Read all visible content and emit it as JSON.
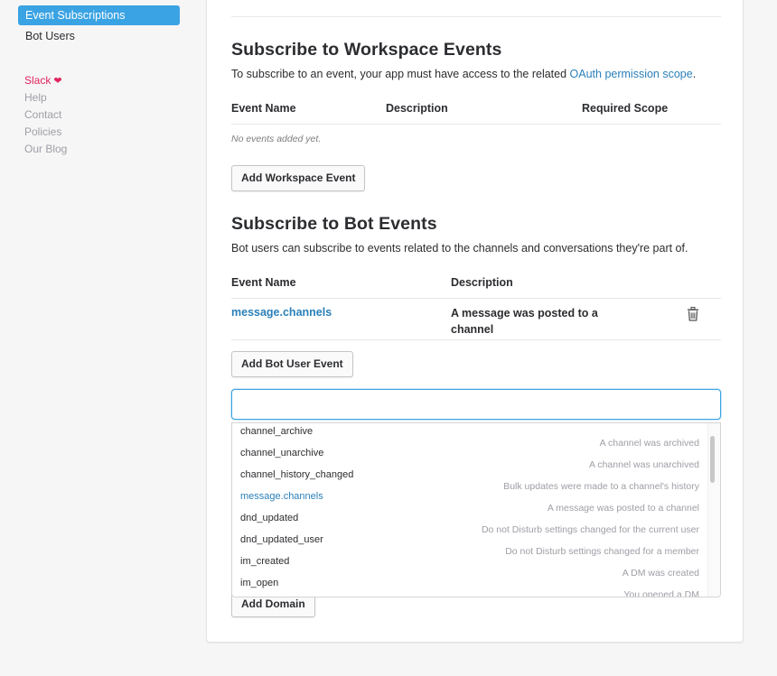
{
  "sidebar": {
    "items": [
      {
        "label": "Event Subscriptions",
        "active": true
      },
      {
        "label": "Bot Users",
        "active": false
      }
    ],
    "footer": {
      "slack": "Slack",
      "help": "Help",
      "contact": "Contact",
      "policies": "Policies",
      "blog": "Our Blog"
    }
  },
  "workspace_events": {
    "title": "Subscribe to Workspace Events",
    "subtitle_prefix": "To subscribe to an event, your app must have access to the related ",
    "subtitle_link": "OAuth permission scope",
    "subtitle_suffix": ".",
    "columns": [
      "Event Name",
      "Description",
      "Required Scope"
    ],
    "empty_text": "No events added yet.",
    "add_button": "Add Workspace Event"
  },
  "bot_events": {
    "title": "Subscribe to Bot Events",
    "subtitle": "Bot users can subscribe to events related to the channels and conversations they're part of.",
    "columns": [
      "Event Name",
      "Description"
    ],
    "rows": [
      {
        "name": "message.channels",
        "description": "A message was posted to a channel"
      }
    ],
    "add_button": "Add Bot User Event"
  },
  "event_search": {
    "value": "",
    "placeholder": ""
  },
  "dropdown": {
    "options": [
      {
        "name": "channel_archive",
        "description": ""
      },
      {
        "name": "channel_unarchive",
        "description": "A channel was archived"
      },
      {
        "name": "channel_history_changed",
        "description": "A channel was unarchived"
      },
      {
        "name": "message.channels",
        "description": "Bulk updates were made to a channel's history",
        "selected": true
      },
      {
        "name": "dnd_updated",
        "description": "A message was posted to a channel"
      },
      {
        "name": "dnd_updated_user",
        "description": "Do not Disturb settings changed for the current user"
      },
      {
        "name": "im_created",
        "description": "Do not Disturb settings changed for a member"
      },
      {
        "name": "im_open",
        "description": "A DM was created"
      },
      {
        "name": "",
        "description": "You opened a DM"
      }
    ]
  },
  "add_domain_button": "Add Domain",
  "colors": {
    "accent": "#3aa3e3",
    "link": "#2a80b9",
    "heart": "#e0245e"
  }
}
